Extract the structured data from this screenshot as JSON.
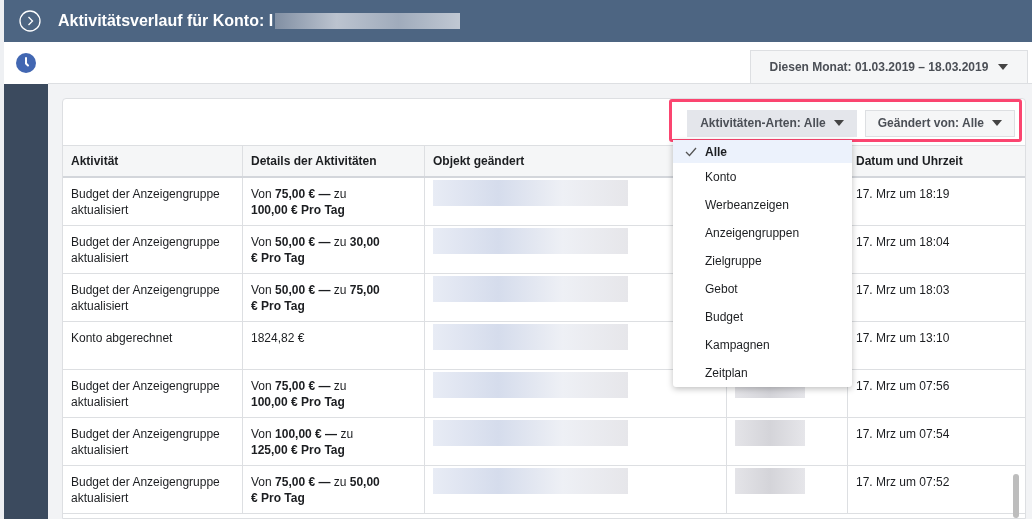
{
  "header": {
    "title": "Aktivitätsverlauf für Konto: I"
  },
  "date_range": {
    "label": "Diesen Monat: 01.03.2019 – 18.03.2019"
  },
  "filters": [
    {
      "label": "Aktivitäten-Arten: Alle",
      "open": true
    },
    {
      "label": "Geändert von: Alle",
      "open": false
    }
  ],
  "activity_type_menu": [
    {
      "label": "Alle",
      "selected": true
    },
    {
      "label": "Konto",
      "selected": false
    },
    {
      "label": "Werbeanzeigen",
      "selected": false
    },
    {
      "label": "Anzeigengruppen",
      "selected": false
    },
    {
      "label": "Zielgruppe",
      "selected": false
    },
    {
      "label": "Gebot",
      "selected": false
    },
    {
      "label": "Budget",
      "selected": false
    },
    {
      "label": "Kampagnen",
      "selected": false
    },
    {
      "label": "Zeitplan",
      "selected": false
    }
  ],
  "table": {
    "columns": [
      "Aktivität",
      "Details der Aktivitäten",
      "Objekt geändert",
      "Datum und Uhrzeit"
    ],
    "rows": [
      {
        "activity": "Budget der Anzeigengruppe aktualisiert",
        "details": "Von **75,00 € —** zu **100,00 € Pro Tag**",
        "date": "17. Mrz um 18:19"
      },
      {
        "activity": "Budget der Anzeigengruppe aktualisiert",
        "details": "Von **50,00 € —** zu **30,00 € Pro Tag**",
        "date": "17. Mrz um 18:04"
      },
      {
        "activity": "Budget der Anzeigengruppe aktualisiert",
        "details": "Von **50,00 € —** zu **75,00 € Pro Tag**",
        "date": "17. Mrz um 18:03"
      },
      {
        "activity": "Konto abgerechnet",
        "details": "1824,82 €",
        "date": "17. Mrz um 13:10"
      },
      {
        "activity": "Budget der Anzeigengruppe aktualisiert",
        "details": "Von **75,00 € —** zu **100,00 € Pro Tag**",
        "date": "17. Mrz um 07:56"
      },
      {
        "activity": "Budget der Anzeigengruppe aktualisiert",
        "details": "Von **100,00 € —** zu **125,00 € Pro Tag**",
        "date": "17. Mrz um 07:54"
      },
      {
        "activity": "Budget der Anzeigengruppe aktualisiert",
        "details": "Von **75,00 € —** zu **50,00 € Pro Tag**",
        "date": "17. Mrz um 07:52"
      }
    ]
  }
}
